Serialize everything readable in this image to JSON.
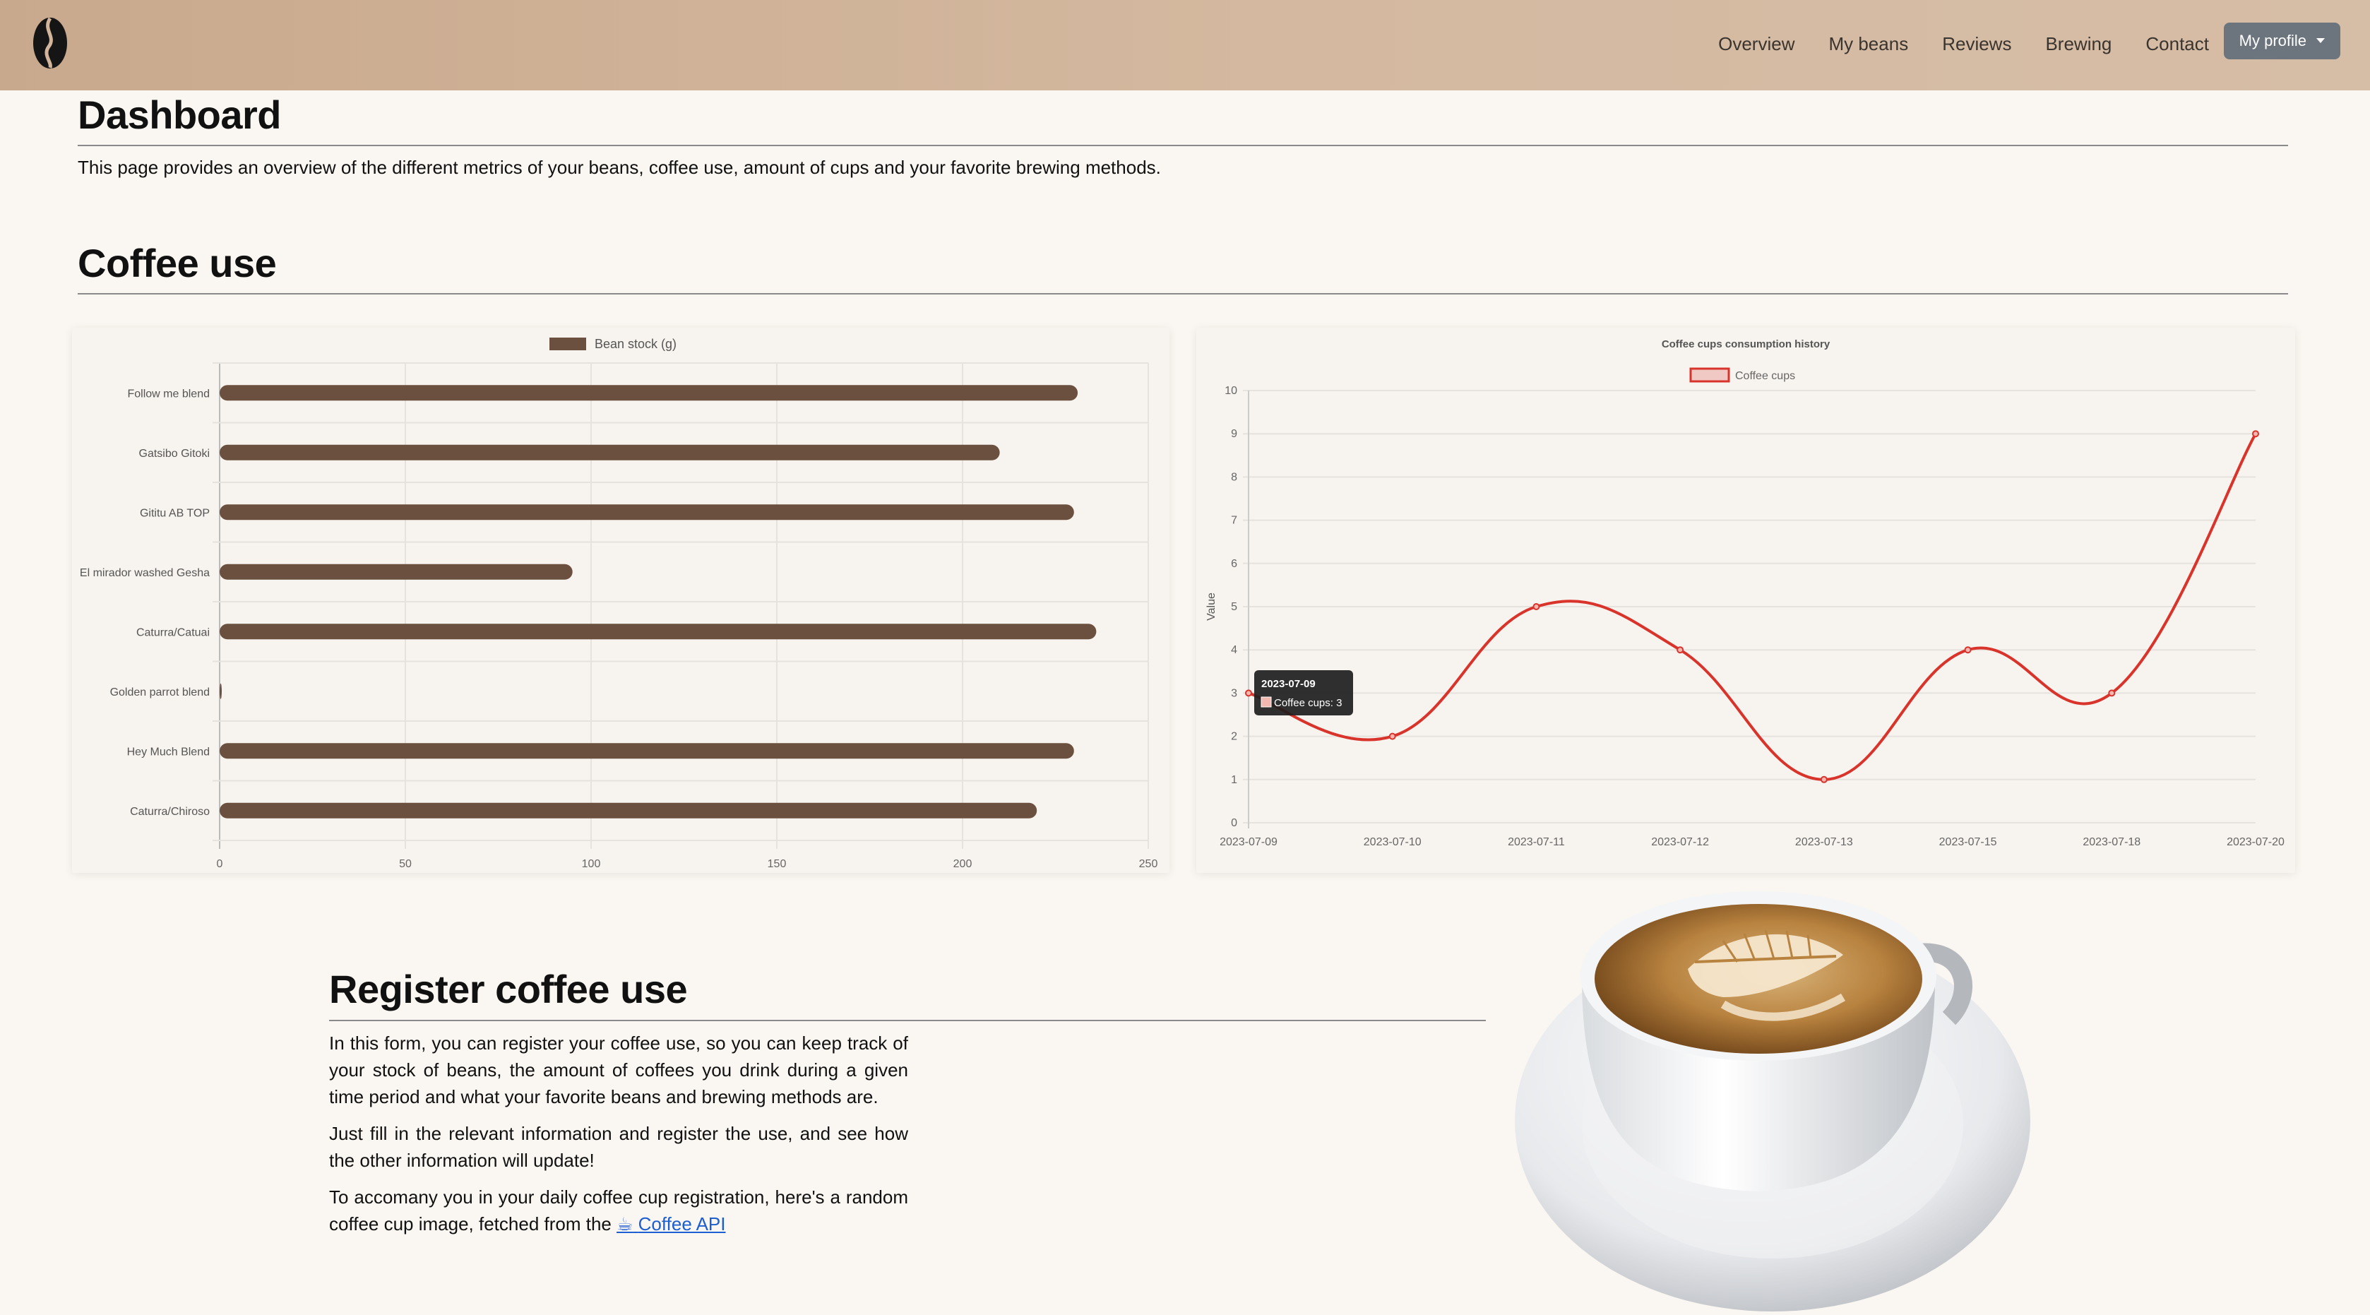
{
  "nav": {
    "brand_icon": "coffee-bean-icon",
    "links": [
      "Overview",
      "My beans",
      "Reviews",
      "Brewing",
      "Contact"
    ],
    "profile_label": "My profile"
  },
  "dashboard": {
    "title": "Dashboard",
    "intro": "This page provides an overview of the different metrics of your beans, coffee use, amount of cups and your favorite brewing methods."
  },
  "coffee_use": {
    "title": "Coffee use"
  },
  "chart_data": [
    {
      "type": "bar",
      "orientation": "horizontal",
      "legend": "Bean stock (g)",
      "legend_position": "top",
      "color": "#6b4f3f",
      "categories": [
        "Follow me blend",
        "Gatsibo Gitoki",
        "Gititu AB TOP",
        "El mirador washed Gesha",
        "Caturra/Catuai",
        "Golden parrot blend",
        "Hey Much Blend",
        "Caturra/Chiroso"
      ],
      "values": [
        231,
        210,
        230,
        95,
        236,
        0.5,
        230,
        220
      ],
      "xlim": [
        0,
        250
      ],
      "x_ticks": [
        "0",
        "50",
        "100",
        "150",
        "200",
        "250"
      ],
      "grid": true
    },
    {
      "type": "line",
      "title": "Coffee cups consumption history",
      "legend": "Coffee cups",
      "legend_position": "top",
      "color": "#d9342b",
      "ylabel": "Value",
      "x": [
        "2023-07-09",
        "2023-07-10",
        "2023-07-11",
        "2023-07-12",
        "2023-07-13",
        "2023-07-15",
        "2023-07-18",
        "2023-07-20"
      ],
      "values": [
        3,
        2,
        5,
        4,
        1,
        4,
        3,
        9
      ],
      "ylim": [
        0,
        10
      ],
      "y_ticks": [
        "0",
        "1",
        "2",
        "3",
        "4",
        "5",
        "6",
        "7",
        "8",
        "9",
        "10"
      ],
      "grid": true,
      "tooltip": {
        "title": "2023-07-09",
        "body": "Coffee cups: 3"
      }
    }
  ],
  "register": {
    "title": "Register coffee use",
    "p1": "In this form, you can register your coffee use, so you can keep track of your stock of beans, the amount of coffees you drink during a given time period and what your favorite beans and brewing methods are.",
    "p2": "Just fill in the relevant information and register the use, and see how the other information will update!",
    "p3_prefix": "To accomany you in your daily coffee cup registration, here's a random coffee cup image, fetched from the ",
    "link_icon": "☕",
    "link_text": "Coffee API"
  },
  "image": {
    "subject": "latte-art-coffee-cup-image"
  }
}
